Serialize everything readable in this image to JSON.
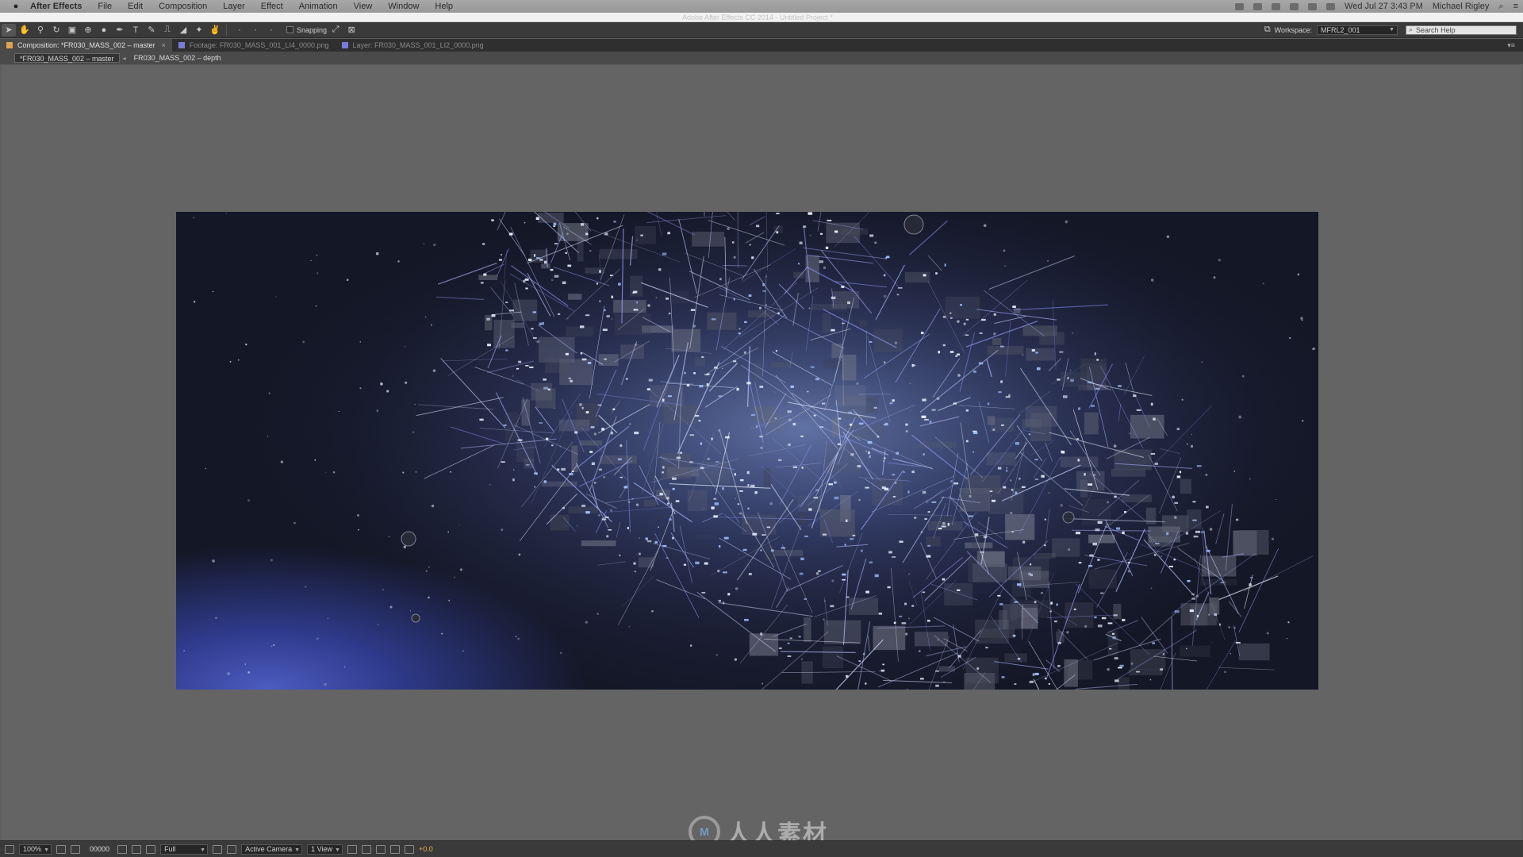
{
  "menubar": {
    "apple": "",
    "app_name": "After Effects",
    "items": [
      "File",
      "Edit",
      "Composition",
      "Layer",
      "Effect",
      "Animation",
      "View",
      "Window",
      "Help"
    ],
    "datetime": "Wed Jul 27  3:43 PM",
    "user": "Michael Rigley"
  },
  "window": {
    "title": "Adobe After Effects CC 2014 - Untitled Project *"
  },
  "toolbar": {
    "snapping_label": "Snapping",
    "workspace_label": "Workspace:",
    "workspace_value": "MFRL2_001",
    "search_placeholder": "Search Help"
  },
  "panel_tabs": [
    {
      "label": "Composition: *FR030_MASS_002 – master",
      "color": "#e0a050",
      "active": true
    },
    {
      "label": "Footage: FR030_MASS_001_LI4_0000.png",
      "color": "#7a7ad8",
      "active": false
    },
    {
      "label": "Layer: FR030_MASS_001_LI2_0000.png",
      "color": "#7a7ad8",
      "active": false
    }
  ],
  "breadcrumbs": {
    "current": "*FR030_MASS_002 – master",
    "next": "FR030_MASS_002 – depth"
  },
  "viewer_bar": {
    "zoom": "100%",
    "timecode": "00000",
    "resolution": "Full",
    "camera": "Active Camera",
    "views": "1 View",
    "exposure": "+0.0"
  },
  "watermark": {
    "logo": "M",
    "text": "人人素材"
  },
  "colors": {
    "menubar": "#9e9e9e",
    "panel": "#3a3a3a",
    "viewer": "#646464",
    "accent": "#e8b04a"
  }
}
